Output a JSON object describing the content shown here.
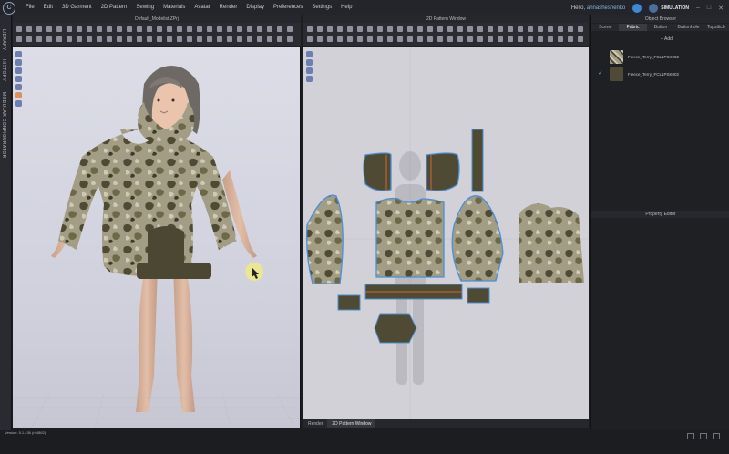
{
  "app": {
    "logo_letter": "C"
  },
  "menu": [
    "File",
    "Edit",
    "3D Garment",
    "2D Pattern",
    "Sewing",
    "Materials",
    "Avatar",
    "Render",
    "Display",
    "Preferences",
    "Settings",
    "Help"
  ],
  "header": {
    "greeting_prefix": "Hello, ",
    "username": "annasheshenko",
    "simulation_label": "SIMULATION"
  },
  "left_rail": {
    "tabs": [
      "LIBRARY",
      "HISTORY",
      "MODULAR CONFIGURATOR"
    ]
  },
  "viewport3d": {
    "title": "Default_Modelist.ZPrj"
  },
  "pattern_window": {
    "title": "2D Pattern Window"
  },
  "bottom_tabs": [
    "Render",
    "2D Pattern Window"
  ],
  "object_browser": {
    "title": "Object Browser",
    "tabs": [
      "Scene",
      "Fabric",
      "Button",
      "Buttonhole",
      "Topstitch"
    ],
    "active_tab": "Fabric",
    "add_label": "Add",
    "fabrics": [
      {
        "name": "Fleece_Terry_FCL1PSK002",
        "selected": false
      },
      {
        "name": "Fleece_Terry_FCL1PSK002",
        "selected": true
      }
    ]
  },
  "property_editor": {
    "title": "Property Editor"
  },
  "version": "Version: 5.1.436 (r44862)",
  "colors": {
    "accent": "#3b89d8",
    "camo_dark": "#4e4a33",
    "camo_light": "#a29d84",
    "outline": "#4d8fd6"
  }
}
